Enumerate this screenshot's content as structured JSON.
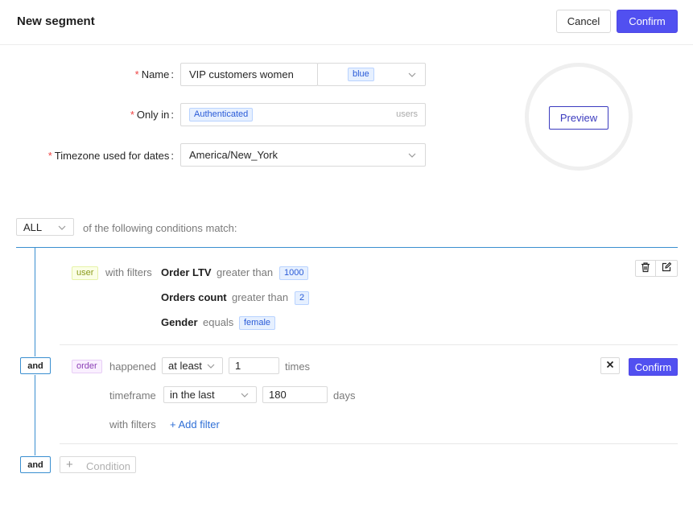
{
  "header": {
    "title": "New segment",
    "cancel_label": "Cancel",
    "confirm_label": "Confirm"
  },
  "form": {
    "name_label": "Name",
    "name_value": "VIP customers women",
    "color_tag": "blue",
    "only_in_label": "Only in",
    "only_in_tag": "Authenticated",
    "only_in_suffix": "users",
    "timezone_label": "Timezone used for dates",
    "timezone_value": "America/New_York",
    "required_mark": "*",
    "colon": ":"
  },
  "preview": {
    "button_label": "Preview"
  },
  "match": {
    "selector": "ALL",
    "text": "of the following conditions match:"
  },
  "conditions": [
    {
      "entity": "user",
      "with_filters_label": "with filters",
      "filters": [
        {
          "field": "Order LTV",
          "operator": "greater than",
          "value": "1000"
        },
        {
          "field": "Orders count",
          "operator": "greater than",
          "value": "2"
        },
        {
          "field": "Gender",
          "operator": "equals",
          "value": "female"
        }
      ]
    },
    {
      "connector": "and",
      "entity": "order",
      "happened_label": "happened",
      "frequency": "at least",
      "count": "1",
      "times_label": "times",
      "timeframe_label": "timeframe",
      "timeframe_op": "in the last",
      "timeframe_value": "180",
      "days_label": "days",
      "with_filters_label": "with filters",
      "add_filter_label": "+ Add filter",
      "confirm_label": "Confirm"
    }
  ],
  "add_condition": {
    "connector": "and",
    "plus": "+",
    "label": "Condition"
  },
  "colors": {
    "primary": "#5150f0",
    "connector": "#3a8fd0",
    "required": "#ef4444"
  },
  "icons": {
    "delete": "trash-icon",
    "edit": "edit-icon",
    "close": "close-icon",
    "dropdown": "chevron-down-icon"
  }
}
